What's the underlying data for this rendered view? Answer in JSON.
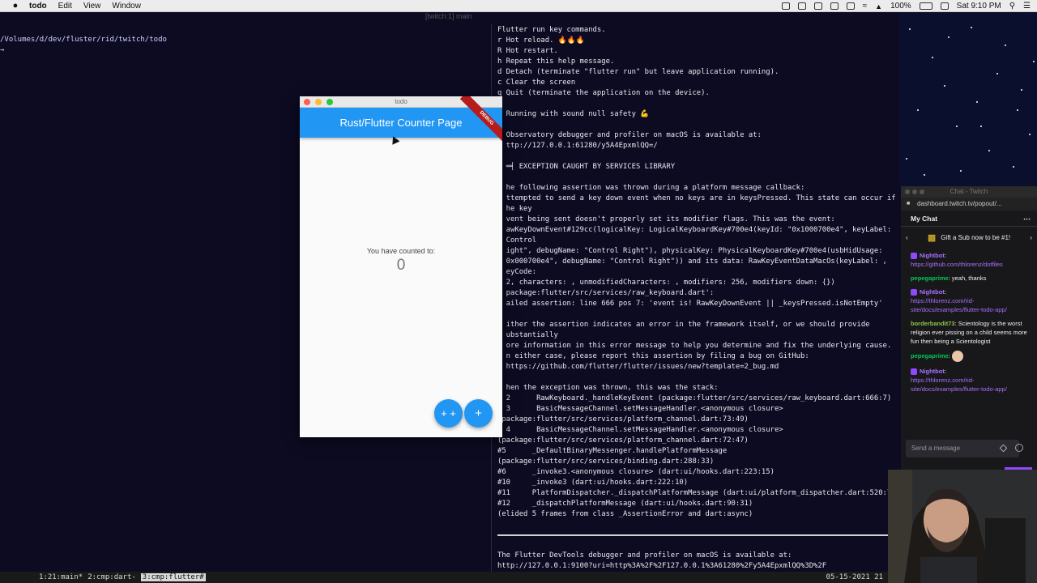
{
  "menubar": {
    "app": "todo",
    "items": [
      "Edit",
      "View",
      "Window"
    ],
    "battery": "100%",
    "clock": "Sat 9:10 PM"
  },
  "tmux_title": "[twitch:1] main",
  "left_pane": {
    "lines": [
      "/Volumes/d/dev/fluster/rid/twitch/todo",
      "→"
    ]
  },
  "right_pane": {
    "lines": [
      "Flutter run key commands.",
      "r Hot reload. 🔥🔥🔥",
      "R Hot restart.",
      "h Repeat this help message.",
      "d Detach (terminate \"flutter run\" but leave application running).",
      "c Clear the screen",
      "q Quit (terminate the application on the device).",
      "",
      "  Running with sound null safety 💪",
      "",
      "  Observatory debugger and profiler on macOS is available at:",
      "  ttp://127.0.0.1:61280/y5A4EpxmlQQ=/",
      "",
      "  ═╡ EXCEPTION CAUGHT BY SERVICES LIBRARY",
      "",
      "  he following assertion was thrown during a platform message callback:",
      "  ttempted to send a key down event when no keys are in keysPressed. This state can occur if",
      "  he key",
      "  vent being sent doesn't properly set its modifier flags. This was the event:",
      "  awKeyDownEvent#129cc(logicalKey: LogicalKeyboardKey#700e4(keyId: \"0x1000700e4\", keyLabel:",
      "  Control",
      "  ight\", debugName: \"Control Right\"), physicalKey: PhysicalKeyboardKey#700e4(usbHidUsage:",
      "  0x000700e4\", debugName: \"Control Right\")) and its data: RawKeyEventDataMacOs(keyLabel: ,",
      "  eyCode:",
      "  2, characters: , unmodifiedCharacters: , modifiers: 256, modifiers down: {})",
      "  package:flutter/src/services/raw_keyboard.dart':",
      "  ailed assertion: line 666 pos 7: 'event is! RawKeyDownEvent || _keysPressed.isNotEmpty'",
      "",
      "  ither the assertion indicates an error in the framework itself, or we should provide",
      "  ubstantially",
      "  ore information in this error message to help you determine and fix the underlying cause.",
      "  n either case, please report this assertion by filing a bug on GitHub:",
      "  https://github.com/flutter/flutter/issues/new?template=2_bug.md",
      "",
      "  hen the exception was thrown, this was the stack:",
      "  2      RawKeyboard._handleKeyEvent (package:flutter/src/services/raw_keyboard.dart:666:7)",
      "  3      BasicMessageChannel.setMessageHandler.<anonymous closure>",
      "(package:flutter/src/services/platform_channel.dart:73:49)",
      "  4      BasicMessageChannel.setMessageHandler.<anonymous closure>",
      "(package:flutter/src/services/platform_channel.dart:72:47)",
      "#5      _DefaultBinaryMessenger.handlePlatformMessage",
      "(package:flutter/src/services/binding.dart:288:33)",
      "#6      _invoke3.<anonymous closure> (dart:ui/hooks.dart:223:15)",
      "#10     _invoke3 (dart:ui/hooks.dart:222:10)",
      "#11     PlatformDispatcher._dispatchPlatformMessage (dart:ui/platform_dispatcher.dart:520:7)",
      "#12     _dispatchPlatformMessage (dart:ui/hooks.dart:90:31)",
      "(elided 5 frames from class _AssertionError and dart:async)",
      "",
      "SEP",
      "",
      "The Flutter DevTools debugger and profiler on macOS is available at:",
      "http://127.0.0.1:9100?uri=http%3A%2F%2F127.0.0.1%3A61280%2Fy5A4EpxmlQQ%3D%2F",
      "▯"
    ]
  },
  "statusbar": {
    "tabs": [
      "1:21:main*",
      "2:cmp:dart-",
      "3:cmp:flutter#"
    ],
    "active_tab": 2,
    "datetime": "05-15-2021 21"
  },
  "flutter_app": {
    "window_title": "todo",
    "appbar_title": "Rust/Flutter Counter Page",
    "debug_banner": "DEBUG",
    "counter_label": "You have counted to:",
    "counter_value": "0",
    "fab_double": "+ +",
    "fab_single": "+"
  },
  "chat": {
    "window_title": "Chat - Twitch",
    "url": "dashboard.twitch.tv/popout/...",
    "header": "My Chat",
    "gift_text": "Gift a Sub now to be #1!",
    "messages": [
      {
        "user": "Nightbot",
        "color": "#a970ff",
        "badge": true,
        "text": "https://github.com/thlorenz/dotfiles",
        "link": true
      },
      {
        "user": "pepegaprime",
        "color": "#00c853",
        "badge": false,
        "text": "yeah, thanks",
        "link": false
      },
      {
        "user": "Nightbot",
        "color": "#a970ff",
        "badge": true,
        "text": "https://thlorenz.com/rid-site/docs/examples/flutter-todo-app/",
        "link": true
      },
      {
        "user": "borderbandit73",
        "color": "#8bc34a",
        "badge": false,
        "text": "Scientology is the worst religion ever pissing on a child seems more fun then being a Scientologist",
        "link": false
      },
      {
        "user": "pepegaprime",
        "color": "#00c853",
        "badge": false,
        "text": "",
        "link": false,
        "emote": true
      },
      {
        "user": "Nightbot",
        "color": "#a970ff",
        "badge": true,
        "text": "https://thlorenz.com/rid-site/docs/examples/flutter-todo-app/",
        "link": true
      }
    ],
    "send_placeholder": "Send a message"
  }
}
